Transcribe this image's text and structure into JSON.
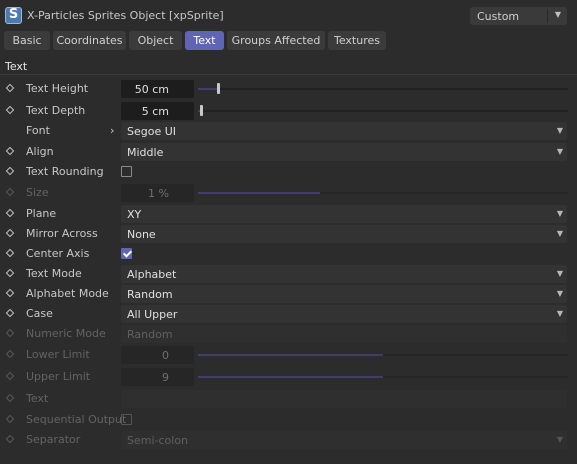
{
  "window": {
    "title": "X-Particles Sprites Object [xpSprite]",
    "app_icon": "S",
    "preset": "Custom"
  },
  "tabs": [
    {
      "label": "Basic",
      "active": false
    },
    {
      "label": "Coordinates",
      "active": false
    },
    {
      "label": "Object",
      "active": false
    },
    {
      "label": "Text",
      "active": true
    },
    {
      "label": "Groups Affected",
      "active": false
    },
    {
      "label": "Textures",
      "active": false
    }
  ],
  "section": {
    "title": "Text"
  },
  "fields": {
    "text_height": {
      "label": "Text Height",
      "value": "50 cm",
      "slider_fraction": 0.05
    },
    "text_depth": {
      "label": "Text Depth",
      "value": "5 cm",
      "slider_fraction": 0.005
    },
    "font": {
      "label": "Font",
      "value": "Segoe UI"
    },
    "align": {
      "label": "Align",
      "value": "Middle"
    },
    "text_rounding": {
      "label": "Text Rounding",
      "checked": false
    },
    "size": {
      "label": "Size",
      "value": "1 %",
      "slider_fraction": 0.33,
      "disabled": true
    },
    "plane": {
      "label": "Plane",
      "value": "XY"
    },
    "mirror_across": {
      "label": "Mirror Across",
      "value": "None"
    },
    "center_axis": {
      "label": "Center Axis",
      "checked": true
    },
    "text_mode": {
      "label": "Text Mode",
      "value": "Alphabet"
    },
    "alphabet_mode": {
      "label": "Alphabet Mode",
      "value": "Random"
    },
    "case": {
      "label": "Case",
      "value": "All Upper"
    },
    "numeric_mode": {
      "label": "Numeric Mode",
      "value": "Random",
      "disabled": true
    },
    "lower_limit": {
      "label": "Lower Limit",
      "value": "0",
      "slider_fraction": 0.5,
      "disabled": true
    },
    "upper_limit": {
      "label": "Upper Limit",
      "value": "9",
      "slider_fraction": 0.5,
      "disabled": true
    },
    "text": {
      "label": "Text",
      "value": "",
      "disabled": true
    },
    "sequential_output": {
      "label": "Sequential Output",
      "checked": false,
      "disabled": true
    },
    "separator": {
      "label": "Separator",
      "value": "Semi-colon",
      "disabled": true
    }
  },
  "colors": {
    "accent": "#5f64b5",
    "background": "#2c2c2c",
    "field_dark": "#1d1d1d",
    "dropdown": "#333333"
  }
}
